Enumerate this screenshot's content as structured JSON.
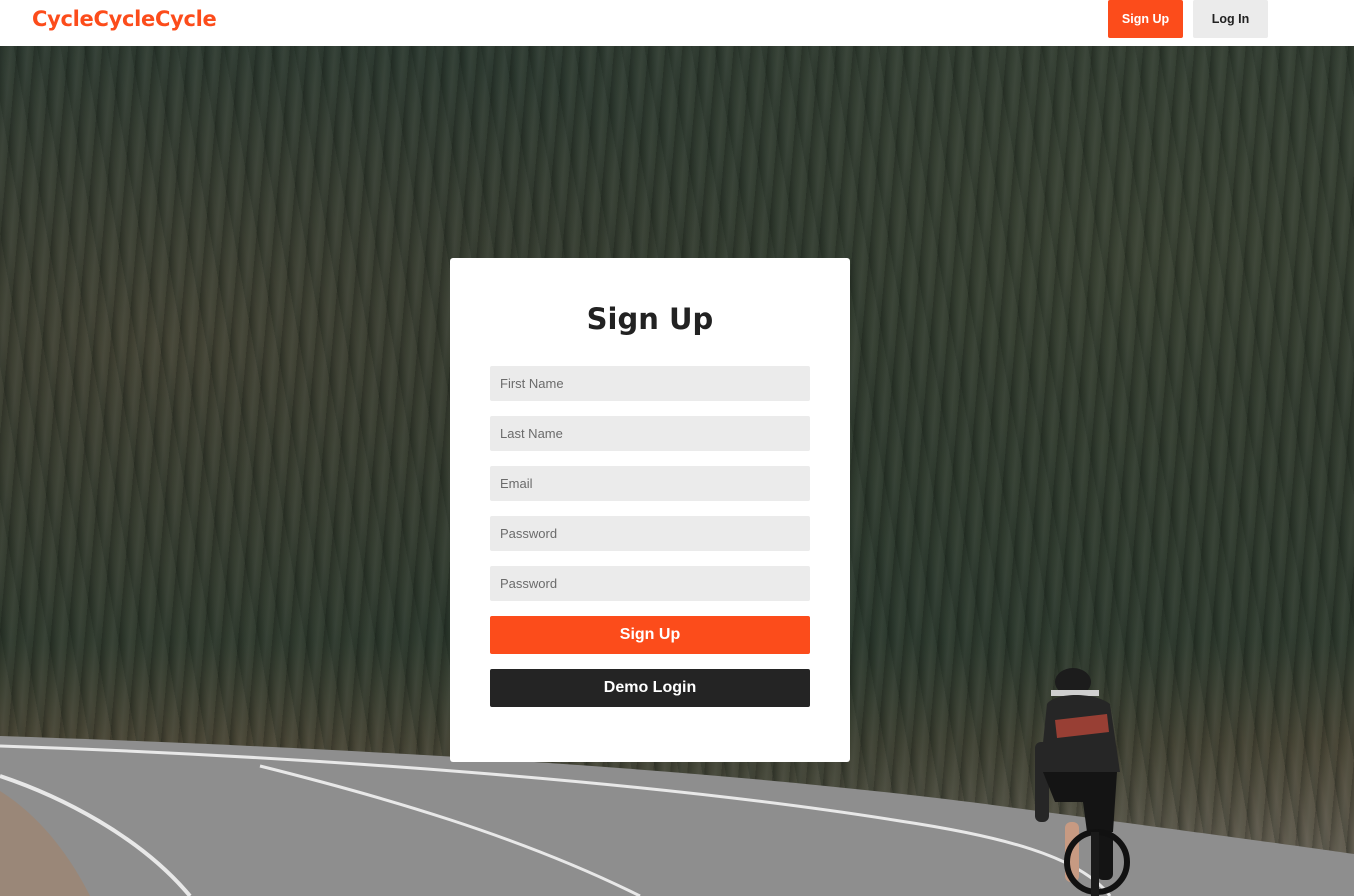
{
  "nav": {
    "brand": "CycleCycleCycle",
    "signup_label": "Sign Up",
    "login_label": "Log In"
  },
  "form": {
    "title": "Sign Up",
    "first_name_placeholder": "First Name",
    "last_name_placeholder": "Last Name",
    "email_placeholder": "Email",
    "password_placeholder": "Password",
    "confirm_password_placeholder": "Password",
    "submit_label": "Sign Up",
    "demo_label": "Demo Login"
  },
  "colors": {
    "accent": "#fc4c1b",
    "dark_button": "#242424",
    "input_bg": "#ebebeb",
    "secondary_button": "#ebebeb"
  }
}
